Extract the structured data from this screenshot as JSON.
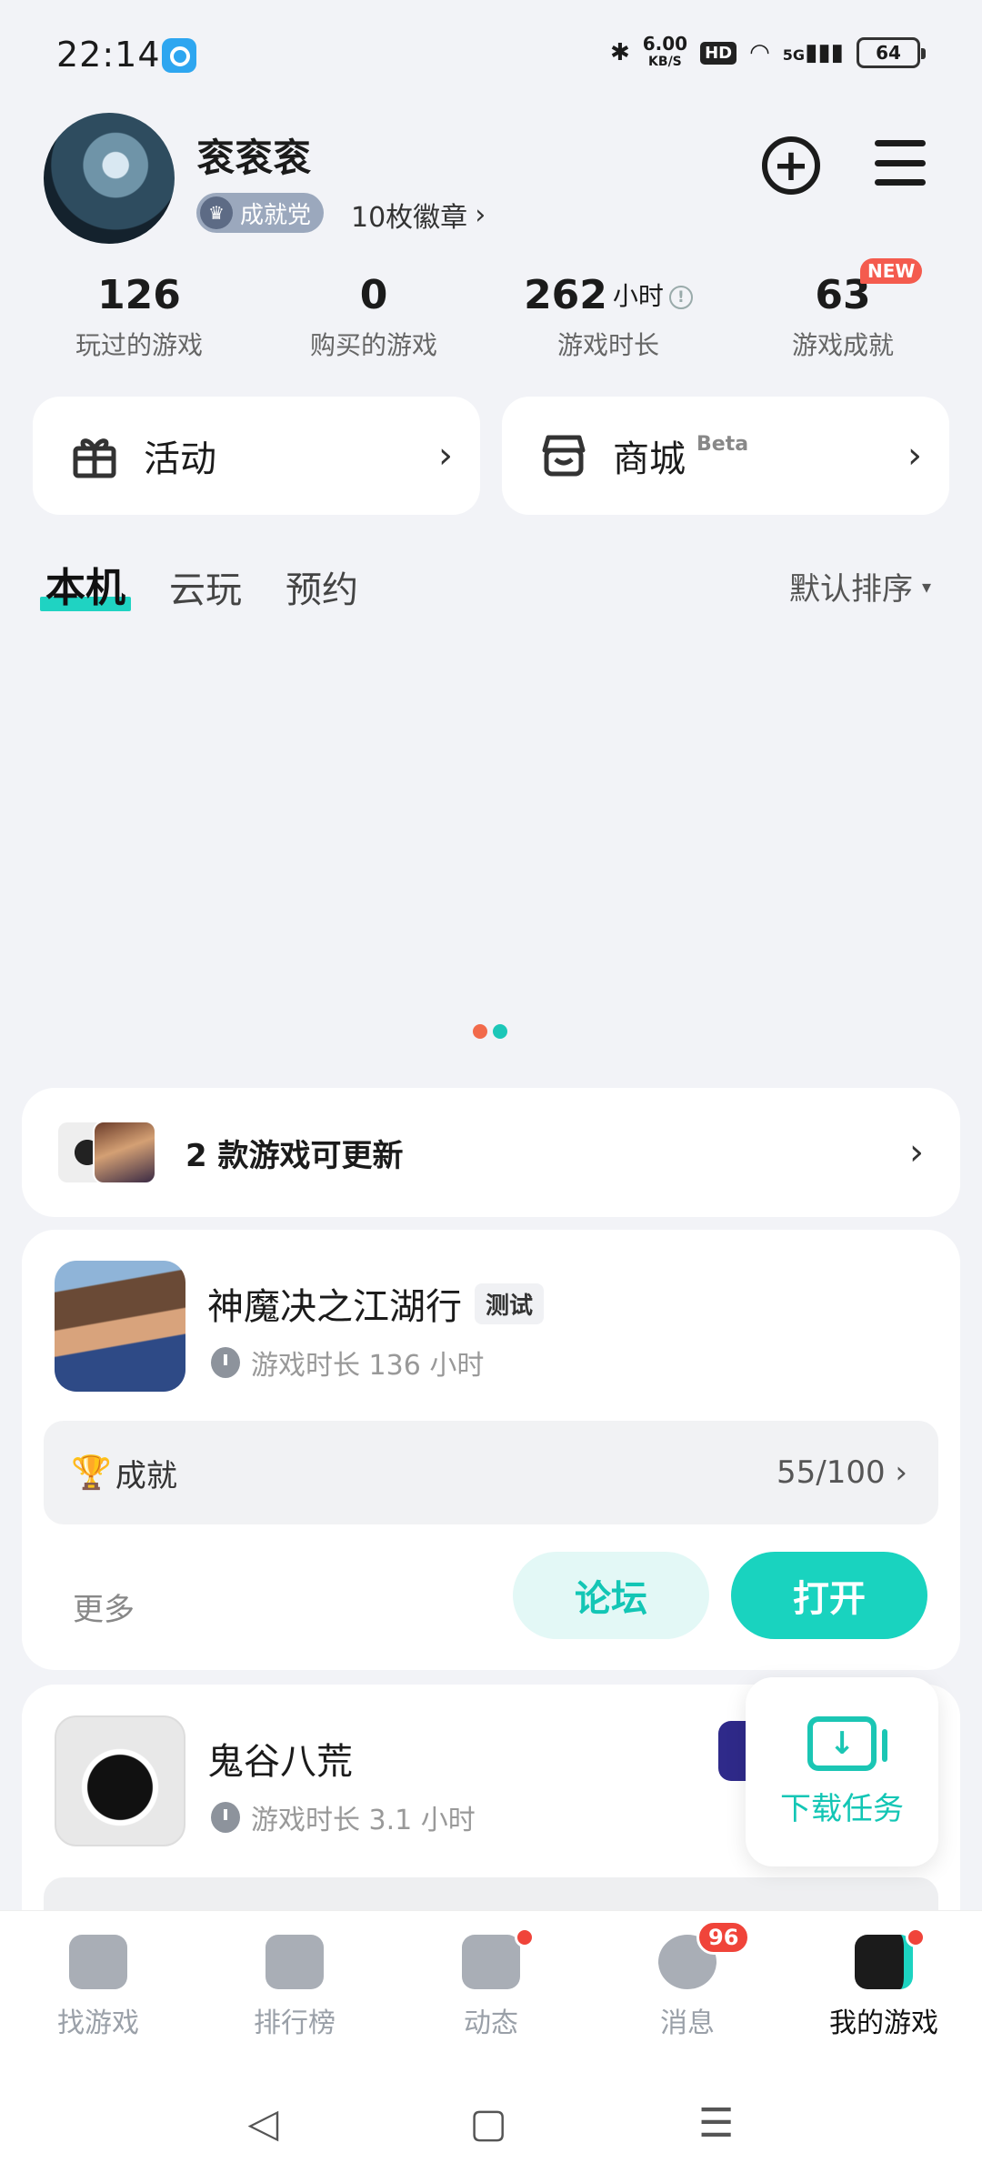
{
  "status_bar": {
    "time": "22:14",
    "net_speed": "6.00",
    "net_unit": "KB/S",
    "hd": "HD",
    "signal": "5G",
    "battery": "64",
    "icons": [
      "bluetooth-icon",
      "wifi-icon",
      "signal-icon"
    ]
  },
  "profile": {
    "username": "衮衮衮",
    "title_badge": "成就党",
    "badge_count": "10枚徽章",
    "chevron": "›"
  },
  "stats": [
    {
      "value": "126",
      "label": "玩过的游戏"
    },
    {
      "value": "0",
      "label": "购买的游戏"
    },
    {
      "value": "262",
      "unit": "小时",
      "label": "游戏时长"
    },
    {
      "value": "63",
      "label": "游戏成就",
      "tag": "NEW"
    }
  ],
  "quick_links": {
    "activity": "活动",
    "shop": "商城",
    "shop_beta": "Beta",
    "arrow": "›"
  },
  "tabs": [
    {
      "label": "本机",
      "active": true
    },
    {
      "label": "云玩",
      "active": false
    },
    {
      "label": "预约",
      "active": false
    }
  ],
  "sort": {
    "label": "默认排序",
    "caret": "▾"
  },
  "carousel_dots": [
    "#f26a4b",
    "#1cc7b8"
  ],
  "update_banner": {
    "text": "2 款游戏可更新",
    "arrow": "›"
  },
  "games": [
    {
      "name": "神魔决之江湖行",
      "tag": "测试",
      "playtime": "游戏时长 136 小时",
      "achievement_label": "成就",
      "achievement_value": "55/100 ›",
      "more": "更多",
      "forum": "论坛",
      "open": "打开"
    },
    {
      "name": "鬼谷八荒",
      "playtime": "游戏时长 3.1 小时"
    }
  ],
  "download_fab": {
    "label": "下载任务"
  },
  "bottom_nav": [
    {
      "label": "找游戏",
      "active": false
    },
    {
      "label": "排行榜",
      "active": false
    },
    {
      "label": "动态",
      "active": false,
      "dot": true
    },
    {
      "label": "消息",
      "active": false,
      "badge": "96"
    },
    {
      "label": "我的游戏",
      "active": true,
      "dot": true
    }
  ],
  "system_nav": {
    "back": "◁",
    "home": "▢",
    "menu": "☰"
  },
  "colors": {
    "accent": "#19d3bf",
    "badge_red": "#f0443a",
    "background": "#f2f3f7"
  }
}
